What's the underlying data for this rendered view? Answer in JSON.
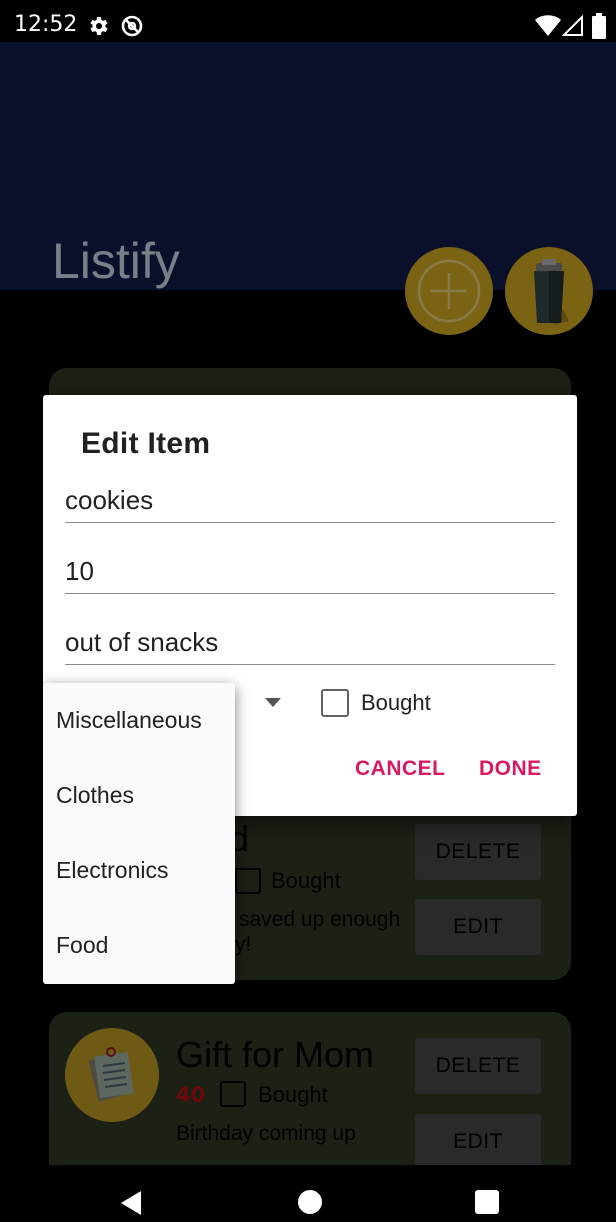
{
  "status_bar": {
    "time": "12:52",
    "icons": [
      "gear-icon",
      "dnd-icon",
      "wifi-icon",
      "signal-icon",
      "battery-icon"
    ]
  },
  "app_bar": {
    "title": "Listify",
    "add_button_icon": "plus-circle-icon",
    "clear_button_icon": "trash-icon"
  },
  "background_cards": [
    {
      "title_visible": "d",
      "bought_label": "Bought",
      "description_lines": [
        "saved up enough",
        "y!"
      ],
      "delete_label": "DELETE",
      "edit_label": "EDIT"
    },
    {
      "title": "Gift for Mom",
      "quantity": "40",
      "bought_label": "Bought",
      "description": "Birthday coming up",
      "delete_label": "DELETE",
      "edit_label": "EDIT",
      "icon": "notepad-icon"
    }
  ],
  "dialog": {
    "title": "Edit Item",
    "name_value": "cookies",
    "quantity_value": "10",
    "description_value": "out of snacks",
    "bought_label": "Bought",
    "bought_checked": false,
    "cancel_label": "CANCEL",
    "done_label": "DONE",
    "accent_color": "#d81b60"
  },
  "category_dropdown": {
    "options": [
      "Miscellaneous",
      "Clothes",
      "Electronics",
      "Food"
    ]
  }
}
